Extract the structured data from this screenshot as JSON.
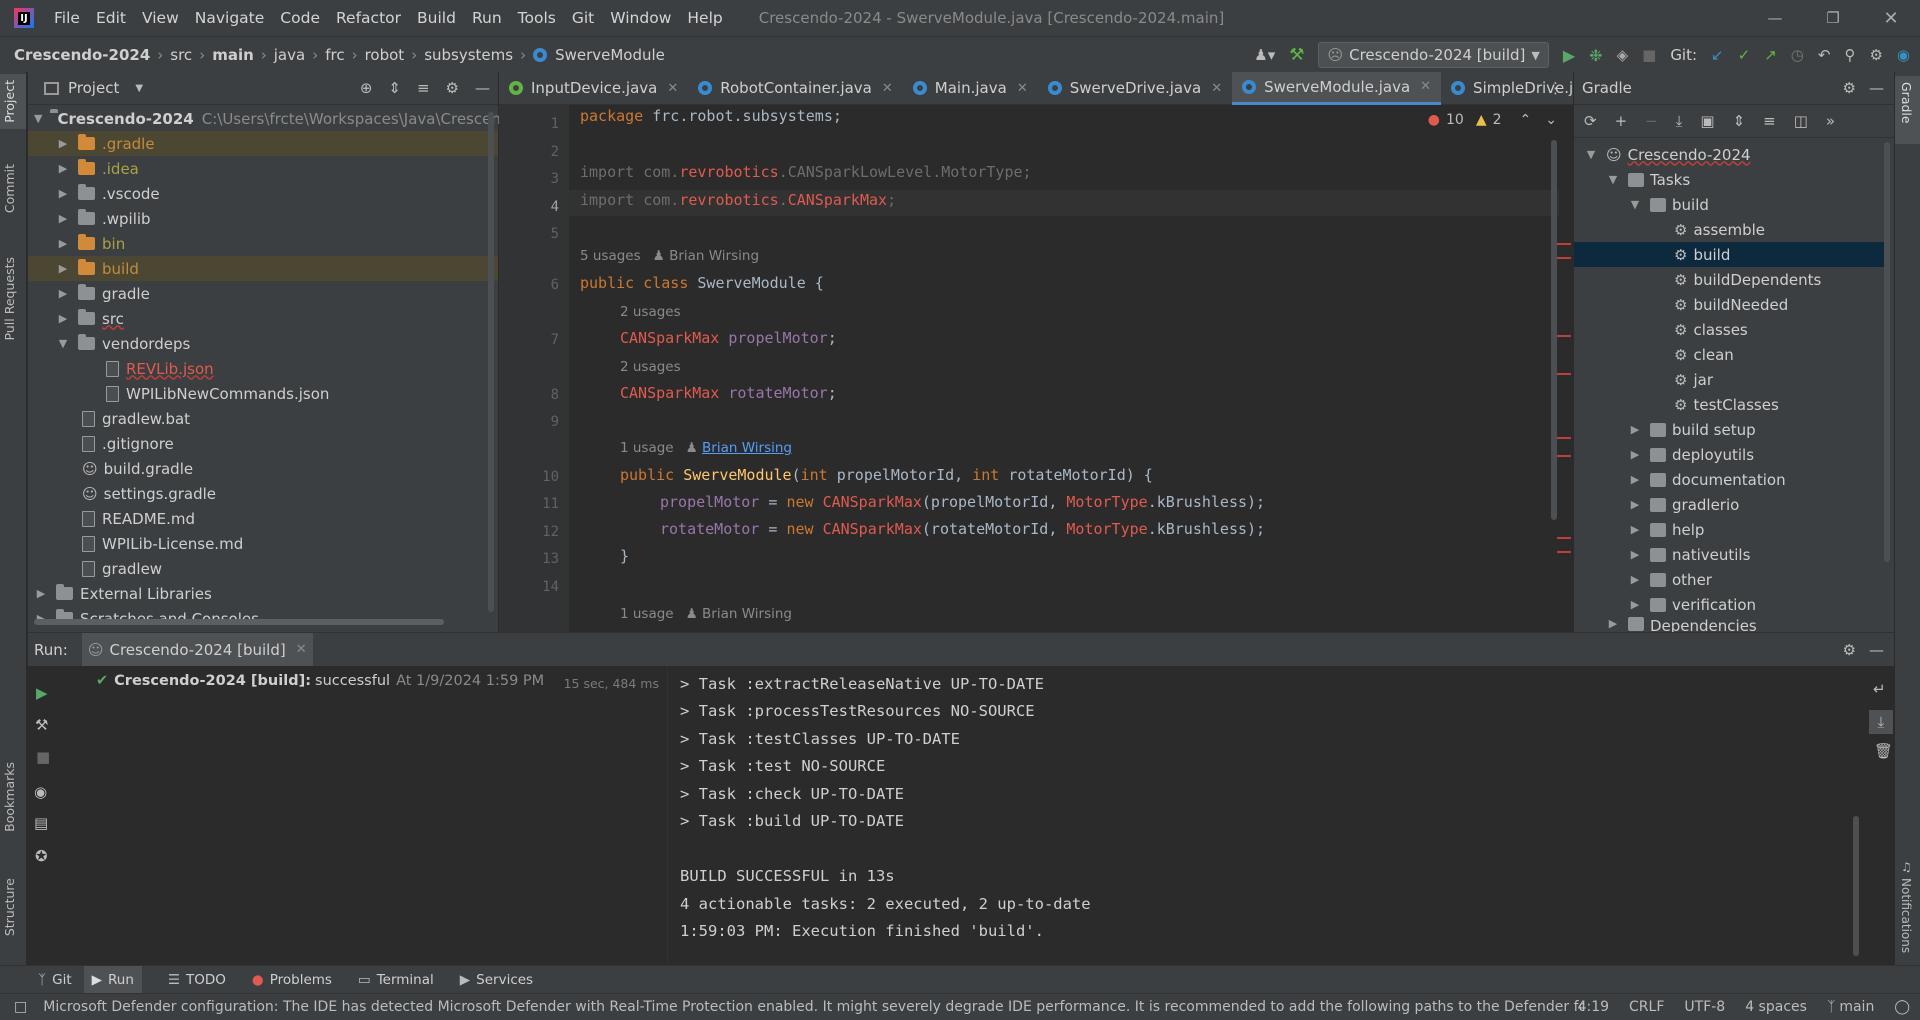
{
  "app": {
    "title": "Crescendo-2024 - SwerveModule.java [Crescendo-2024.main]",
    "logo": "IJ"
  },
  "menu": [
    "File",
    "Edit",
    "View",
    "Navigate",
    "Code",
    "Refactor",
    "Build",
    "Run",
    "Tools",
    "Git",
    "Window",
    "Help"
  ],
  "breadcrumb": [
    "Crescendo-2024",
    "src",
    "main",
    "java",
    "frc",
    "robot",
    "subsystems",
    "SwerveModule"
  ],
  "toolbar": {
    "run_config": "Crescendo-2024 [build]",
    "git_label": "Git:"
  },
  "project_panel": {
    "title": "Project",
    "root": {
      "name": "Crescendo-2024",
      "path": "C:\\Users\\frcte\\Workspaces\\Java\\Crescendo-2"
    },
    "items": [
      {
        "name": ".gradle",
        "kind": "folder-orange",
        "expanded": false
      },
      {
        "name": ".idea",
        "kind": "folder",
        "expanded": false
      },
      {
        "name": ".vscode",
        "kind": "folder",
        "expanded": false
      },
      {
        "name": ".wpilib",
        "kind": "folder",
        "expanded": false
      },
      {
        "name": "bin",
        "kind": "folder-orange",
        "expanded": false
      },
      {
        "name": "build",
        "kind": "folder-orange",
        "expanded": false
      },
      {
        "name": "gradle",
        "kind": "folder",
        "expanded": false
      },
      {
        "name": "src",
        "kind": "folder",
        "expanded": false
      },
      {
        "name": "vendordeps",
        "kind": "folder",
        "expanded": true
      },
      {
        "name": "REVLib.json",
        "kind": "file"
      },
      {
        "name": "WPILibNewCommands.json",
        "kind": "file"
      },
      {
        "name": "gradlew.bat",
        "kind": "file"
      },
      {
        "name": ".gitignore",
        "kind": "file"
      },
      {
        "name": "build.gradle",
        "kind": "file"
      },
      {
        "name": "settings.gradle",
        "kind": "file"
      },
      {
        "name": "README.md",
        "kind": "file"
      },
      {
        "name": "WPILib-License.md",
        "kind": "file"
      },
      {
        "name": "gradlew",
        "kind": "file"
      },
      {
        "name": "External Libraries",
        "kind": "library"
      },
      {
        "name": "Scratches and Consoles",
        "kind": "scratch"
      }
    ]
  },
  "editor": {
    "tabs": [
      "InputDevice.java",
      "RobotContainer.java",
      "Main.java",
      "SwerveDrive.java",
      "SwerveModule.java",
      "SimpleDrive.ja"
    ],
    "active_tab": "SwerveModule.java",
    "errors": "10",
    "warnings": "2",
    "line_numbers": [
      "1",
      "2",
      "3",
      "4",
      "5",
      "6",
      "7",
      "8",
      "9",
      "10",
      "11",
      "12",
      "13",
      "14"
    ],
    "hints": {
      "class_usages": "5 usages",
      "author": "Brian Wirsing",
      "field_usages": "2 usages",
      "ctor_usages": "1 usage"
    }
  },
  "gradle_panel": {
    "title": "Gradle",
    "root": "Crescendo-2024",
    "tasks_label": "Tasks",
    "build_group": "build",
    "build_tasks": [
      "assemble",
      "build",
      "buildDependents",
      "buildNeeded",
      "classes",
      "clean",
      "jar",
      "testClasses"
    ],
    "selected_task": "build",
    "groups": [
      "build setup",
      "deployutils",
      "documentation",
      "gradlerio",
      "help",
      "nativeutils",
      "other",
      "verification"
    ],
    "dependencies": "Dependencies"
  },
  "run_panel": {
    "label": "Run:",
    "tab": "Crescendo-2024 [build]",
    "result_name": "Crescendo-2024 [build]:",
    "result_status": "successful",
    "result_time": "At 1/9/2024 1:59 PM",
    "duration": "15 sec, 484 ms",
    "console": [
      "> Task :extractReleaseNative UP-TO-DATE",
      "> Task :processTestResources NO-SOURCE",
      "> Task :testClasses UP-TO-DATE",
      "> Task :test NO-SOURCE",
      "> Task :check UP-TO-DATE",
      "> Task :build UP-TO-DATE",
      "",
      "BUILD SUCCESSFUL in 13s",
      "4 actionable tasks: 2 executed, 2 up-to-date",
      "1:59:03 PM: Execution finished 'build'."
    ]
  },
  "left_tool_tabs": [
    "Project",
    "Commit",
    "Pull Requests",
    "Bookmarks",
    "Structure"
  ],
  "right_tool_tabs": [
    "Gradle",
    "Notifications"
  ],
  "bottom_tabs": [
    "Git",
    "Run",
    "TODO",
    "Problems",
    "Terminal",
    "Services"
  ],
  "status": {
    "message": "Microsoft Defender configuration: The IDE has detected Microsoft Defender with Real-Time Protection enabled. It might severely degrade IDE performance. It is recommended to add the following paths to the Defender folder exc",
    "position": "4:19",
    "line_sep": "CRLF",
    "encoding": "UTF-8",
    "indent": "4 spaces",
    "branch": "main"
  }
}
